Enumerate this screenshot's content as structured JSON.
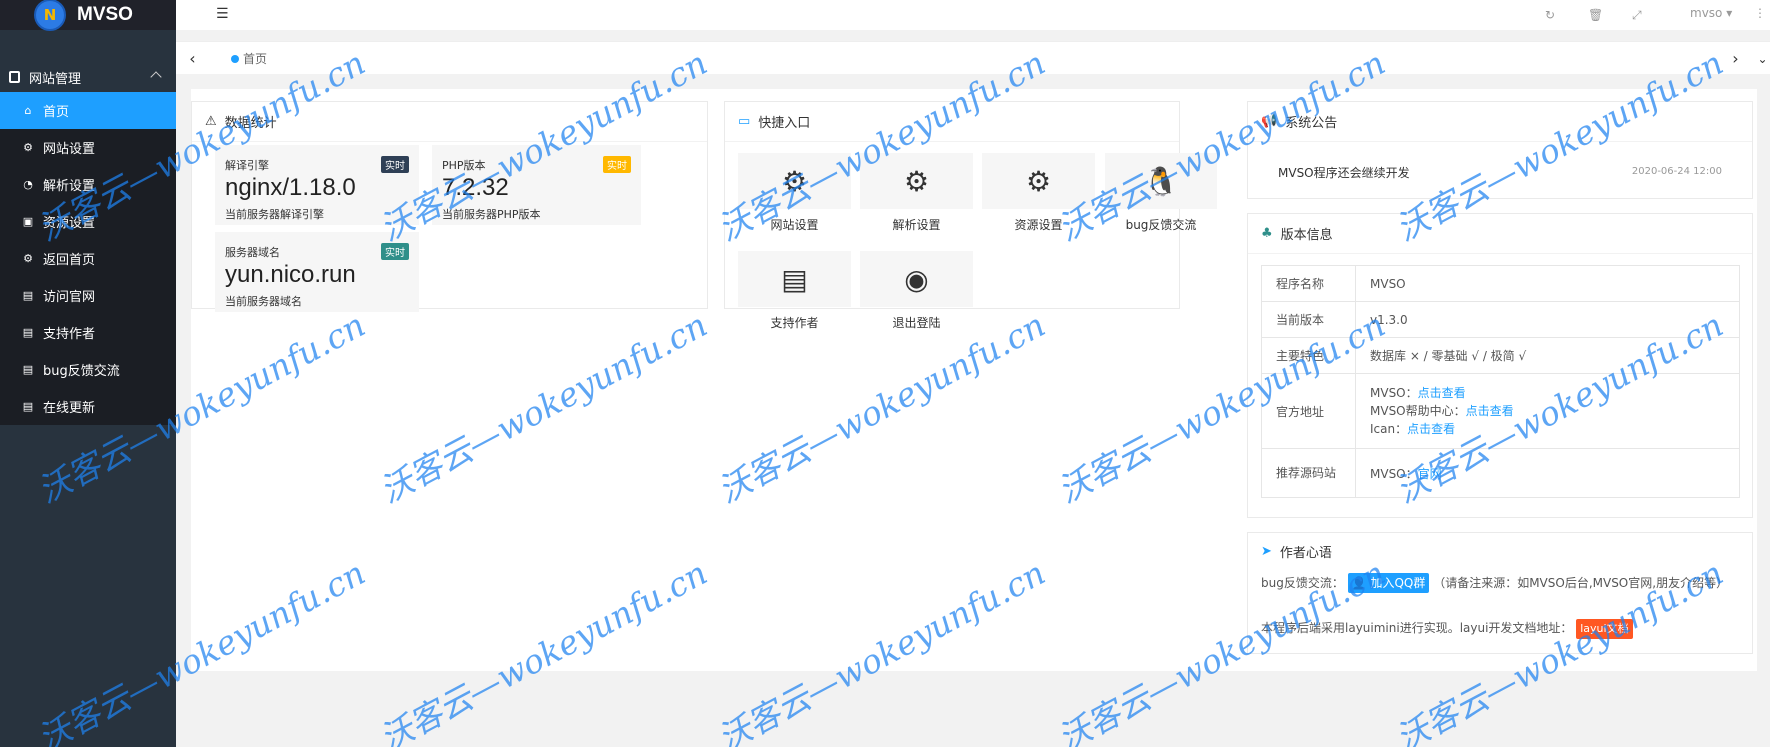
{
  "logo": {
    "mark": "N",
    "name": "MVSO"
  },
  "sidebar": {
    "group": "网站管理",
    "items": [
      {
        "label": "首页",
        "icon": "home-icon"
      },
      {
        "label": "网站设置",
        "icon": "gear-icon"
      },
      {
        "label": "解析设置",
        "icon": "dashboard-icon"
      },
      {
        "label": "资源设置",
        "icon": "calendar-icon"
      },
      {
        "label": "返回首页",
        "icon": "cogs-icon"
      },
      {
        "label": "访问官网",
        "icon": "file-icon"
      },
      {
        "label": "支持作者",
        "icon": "file-icon"
      },
      {
        "label": "bug反馈交流",
        "icon": "file-icon"
      },
      {
        "label": "在线更新",
        "icon": "file-icon"
      }
    ]
  },
  "header": {
    "user": "mvso"
  },
  "tabs": [
    {
      "label": "首页"
    }
  ],
  "stats": {
    "title": "数据统计",
    "items": [
      {
        "label": "解译引擎",
        "badge": "实时",
        "value": "nginx/1.18.0",
        "desc": "当前服务器解译引擎",
        "badge_color": "#2f4056"
      },
      {
        "label": "PHP版本",
        "badge": "实时",
        "value": "7.2.32",
        "desc": "当前服务器PHP版本",
        "badge_color": "#ffb800"
      },
      {
        "label": "服务器域名",
        "badge": "实时",
        "value": "yun.nico.run",
        "desc": "当前服务器域名",
        "badge_color": "#2f8f8a"
      }
    ]
  },
  "quick": {
    "title": "快捷入口",
    "items": [
      {
        "label": "网站设置",
        "icon": "cogs-icon"
      },
      {
        "label": "解析设置",
        "icon": "cogs-icon"
      },
      {
        "label": "资源设置",
        "icon": "cogs-icon"
      },
      {
        "label": "bug反馈交流",
        "icon": "qq-penguin-icon"
      },
      {
        "label": "支持作者",
        "icon": "credit-card-icon"
      },
      {
        "label": "退出登陆",
        "icon": "circle-dot-icon"
      }
    ]
  },
  "notice": {
    "title": "系统公告",
    "text": "MVSO程序还会继续开发",
    "time": "2020-06-24 12:00"
  },
  "version": {
    "title": "版本信息",
    "rows": {
      "name_k": "程序名称",
      "name_v": "MVSO",
      "ver_k": "当前版本",
      "ver_v": "v1.3.0",
      "feat_k": "主要特色",
      "feat_v": "数据库 × / 零基础 √ / 极简 √",
      "site_k": "官方地址",
      "site_1": "MVSO：",
      "site_1_link": "点击查看",
      "site_2": "MVSO帮助中心：",
      "site_2_link": "点击查看",
      "site_3": "Ican：",
      "site_3_link": "点击查看",
      "rec_k": "推荐源码站",
      "rec_v": "MVSO：",
      "rec_link": "官网"
    }
  },
  "author": {
    "title": "作者心语",
    "line1_prefix": "bug反馈交流：",
    "qq_button": "加入QQ群",
    "line1_suffix": "（请备注来源：如MVSO后台,MVSO官网,朋友介绍等）",
    "line2": "本程序后端采用layuimini进行实现。layui开发文档地址：",
    "layui_button": "layui文档"
  },
  "watermark": "沃客云—wokeyunfu.cn"
}
